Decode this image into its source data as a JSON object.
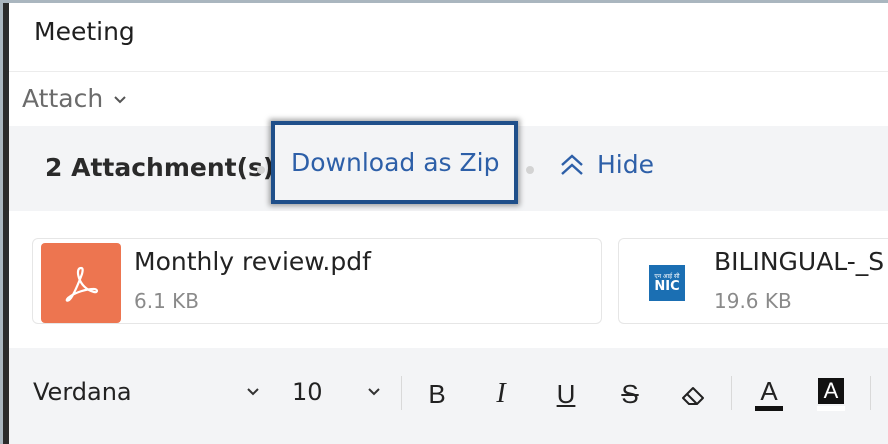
{
  "subject": "Meeting",
  "attach_label": "Attach",
  "attachments": {
    "count_label": "2 Attachment(s)",
    "download_label": "Download as Zip",
    "hide_label": "Hide",
    "files": [
      {
        "name": "Monthly review.pdf",
        "size": "6.1 KB",
        "icon": "pdf-icon",
        "color": "#ed7550"
      },
      {
        "name": "BILINGUAL-_S",
        "size": "19.6 KB",
        "icon": "nic-logo-icon",
        "logo_text_top": "एन आई सी",
        "logo_text_bottom": "NIC"
      }
    ]
  },
  "toolbar": {
    "font_family": "Verdana",
    "font_size": "10",
    "bold": "B",
    "italic": "I",
    "underline": "U",
    "strike": "S",
    "font_color": "A",
    "bg_color": "A"
  },
  "colors": {
    "accent": "#2d5fa8",
    "highlight_border": "#1f4f8a",
    "bar_bg": "#f3f4f6"
  }
}
